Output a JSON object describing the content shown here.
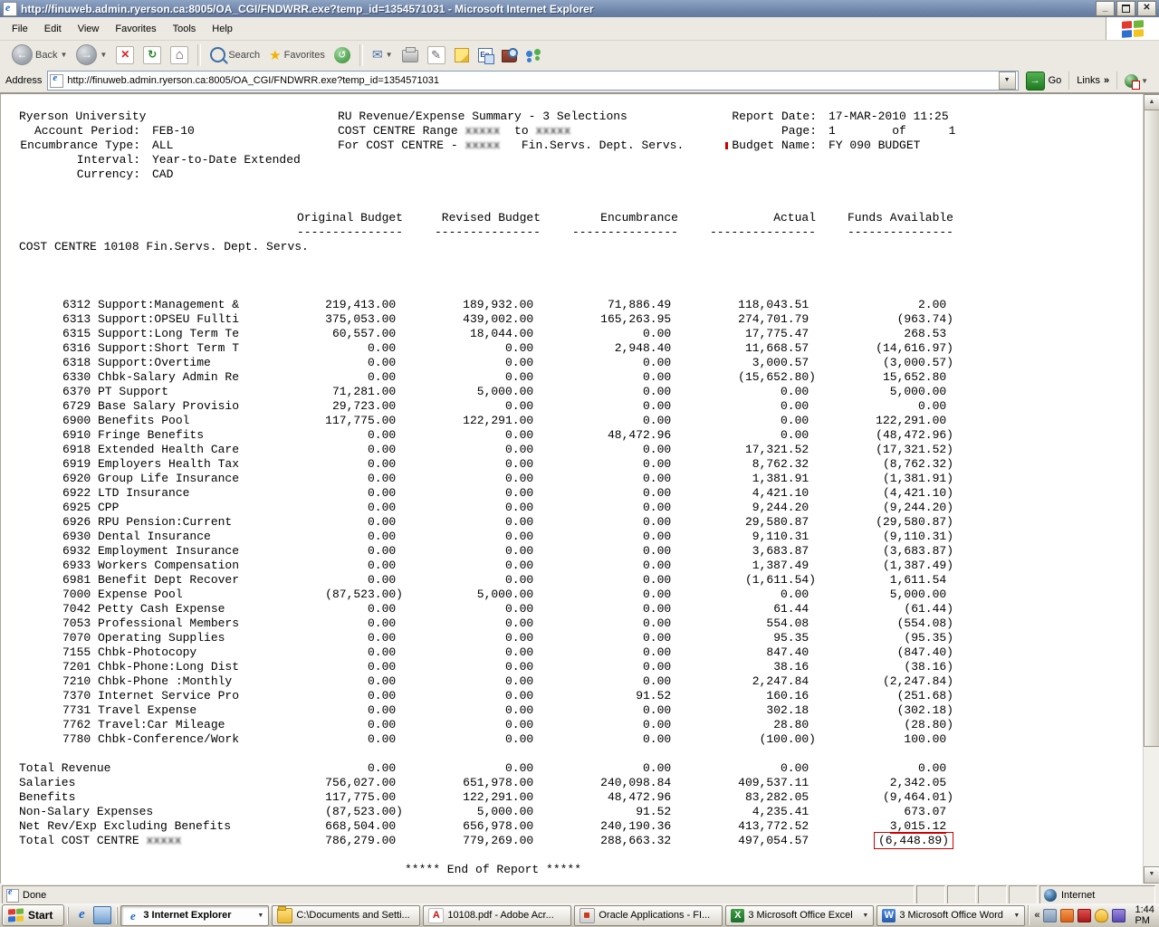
{
  "window": {
    "title": "http://finuweb.admin.ryerson.ca:8005/OA_CGI/FNDWRR.exe?temp_id=1354571031 - Microsoft Internet Explorer"
  },
  "menu": {
    "items": [
      "File",
      "Edit",
      "View",
      "Favorites",
      "Tools",
      "Help"
    ]
  },
  "toolbar": {
    "back_label": "Back",
    "search_label": "Search",
    "favorites_label": "Favorites"
  },
  "icons": {
    "ie": "e",
    "back_arrow": "←",
    "forward_arrow": "→",
    "stop": "✕",
    "refresh": "↻",
    "home": "⌂",
    "favorites_star": "★",
    "history": "↺",
    "mail": "✉",
    "edit": "✎",
    "translate_text": "En",
    "dropdown": "▼",
    "go_arrow": "→",
    "minimize": "_",
    "close": "✕",
    "up_arrow": "▲",
    "down_arrow": "▼",
    "excel": "X",
    "word": "W",
    "acrobat": "A"
  },
  "address": {
    "label": "Address",
    "url": "http://finuweb.admin.ryerson.ca:8005/OA_CGI/FNDWRR.exe?temp_id=1354571031",
    "go_label": "Go",
    "links_label": "Links",
    "chevron": "»"
  },
  "report": {
    "org": "Ryerson University",
    "left_fields": [
      {
        "label": "Account Period:",
        "value": "FEB-10"
      },
      {
        "label": "Encumbrance Type:",
        "value": "ALL"
      },
      {
        "label": "Interval:",
        "value": "Year-to-Date Extended"
      },
      {
        "label": "Currency:",
        "value": "CAD"
      }
    ],
    "title": "RU Revenue/Expense Summary - 3 Selections",
    "range_line_prefix": "COST CENTRE Range ",
    "range_redacted_1": "xxxxx",
    "range_to": "  to ",
    "range_redacted_2": "xxxxx",
    "for_line_prefix": "For COST CENTRE - ",
    "for_redacted": "xxxxx",
    "for_line_suffix": "   Fin.Servs. Dept. Servs.",
    "right_fields": [
      {
        "label": "Report Date:",
        "value": "17-MAR-2010 11:25",
        "mark": false
      },
      {
        "label": "Page:",
        "value": "1        of      1",
        "mark": false
      },
      {
        "label": "Budget Name:",
        "value": "FY 090 BUDGET",
        "mark": true
      }
    ],
    "columns": [
      "Original Budget",
      "Revised Budget",
      "Encumbrance",
      "Actual",
      "Funds Available"
    ],
    "column_underline": "---------------",
    "section_title": "COST CENTRE 10108 Fin.Servs. Dept. Servs.",
    "rows": [
      {
        "code": "6312",
        "name": "Support:Management &",
        "values": [
          "219,413.00",
          "189,932.00",
          "71,886.49",
          "118,043.51",
          "2.00"
        ]
      },
      {
        "code": "6313",
        "name": "Support:OPSEU Fullti",
        "values": [
          "375,053.00",
          "439,002.00",
          "165,263.95",
          "274,701.79",
          "(963.74)"
        ]
      },
      {
        "code": "6315",
        "name": "Support:Long Term Te",
        "values": [
          "60,557.00",
          "18,044.00",
          "0.00",
          "17,775.47",
          "268.53"
        ]
      },
      {
        "code": "6316",
        "name": "Support:Short Term T",
        "values": [
          "0.00",
          "0.00",
          "2,948.40",
          "11,668.57",
          "(14,616.97)"
        ]
      },
      {
        "code": "6318",
        "name": "Support:Overtime",
        "values": [
          "0.00",
          "0.00",
          "0.00",
          "3,000.57",
          "(3,000.57)"
        ]
      },
      {
        "code": "6330",
        "name": "Chbk-Salary Admin Re",
        "values": [
          "0.00",
          "0.00",
          "0.00",
          "(15,652.80)",
          "15,652.80"
        ]
      },
      {
        "code": "6370",
        "name": "PT Support",
        "values": [
          "71,281.00",
          "5,000.00",
          "0.00",
          "0.00",
          "5,000.00"
        ]
      },
      {
        "code": "6729",
        "name": "Base Salary Provisio",
        "values": [
          "29,723.00",
          "0.00",
          "0.00",
          "0.00",
          "0.00"
        ]
      },
      {
        "code": "6900",
        "name": "Benefits Pool",
        "values": [
          "117,775.00",
          "122,291.00",
          "0.00",
          "0.00",
          "122,291.00"
        ]
      },
      {
        "code": "6910",
        "name": "Fringe Benefits",
        "values": [
          "0.00",
          "0.00",
          "48,472.96",
          "0.00",
          "(48,472.96)"
        ]
      },
      {
        "code": "6918",
        "name": "Extended Health Care",
        "values": [
          "0.00",
          "0.00",
          "0.00",
          "17,321.52",
          "(17,321.52)"
        ]
      },
      {
        "code": "6919",
        "name": "Employers Health Tax",
        "values": [
          "0.00",
          "0.00",
          "0.00",
          "8,762.32",
          "(8,762.32)"
        ]
      },
      {
        "code": "6920",
        "name": "Group Life Insurance",
        "values": [
          "0.00",
          "0.00",
          "0.00",
          "1,381.91",
          "(1,381.91)"
        ]
      },
      {
        "code": "6922",
        "name": "LTD Insurance",
        "values": [
          "0.00",
          "0.00",
          "0.00",
          "4,421.10",
          "(4,421.10)"
        ]
      },
      {
        "code": "6925",
        "name": "CPP",
        "values": [
          "0.00",
          "0.00",
          "0.00",
          "9,244.20",
          "(9,244.20)"
        ]
      },
      {
        "code": "6926",
        "name": "RPU Pension:Current",
        "values": [
          "0.00",
          "0.00",
          "0.00",
          "29,580.87",
          "(29,580.87)"
        ]
      },
      {
        "code": "6930",
        "name": "Dental Insurance",
        "values": [
          "0.00",
          "0.00",
          "0.00",
          "9,110.31",
          "(9,110.31)"
        ]
      },
      {
        "code": "6932",
        "name": "Employment Insurance",
        "values": [
          "0.00",
          "0.00",
          "0.00",
          "3,683.87",
          "(3,683.87)"
        ]
      },
      {
        "code": "6933",
        "name": "Workers Compensation",
        "values": [
          "0.00",
          "0.00",
          "0.00",
          "1,387.49",
          "(1,387.49)"
        ]
      },
      {
        "code": "6981",
        "name": "Benefit Dept Recover",
        "values": [
          "0.00",
          "0.00",
          "0.00",
          "(1,611.54)",
          "1,611.54"
        ]
      },
      {
        "code": "7000",
        "name": "Expense Pool",
        "values": [
          "(87,523.00)",
          "5,000.00",
          "0.00",
          "0.00",
          "5,000.00"
        ]
      },
      {
        "code": "7042",
        "name": "Petty Cash Expense",
        "values": [
          "0.00",
          "0.00",
          "0.00",
          "61.44",
          "(61.44)"
        ]
      },
      {
        "code": "7053",
        "name": "Professional Members",
        "values": [
          "0.00",
          "0.00",
          "0.00",
          "554.08",
          "(554.08)"
        ]
      },
      {
        "code": "7070",
        "name": "Operating Supplies",
        "values": [
          "0.00",
          "0.00",
          "0.00",
          "95.35",
          "(95.35)"
        ]
      },
      {
        "code": "7155",
        "name": "Chbk-Photocopy",
        "values": [
          "0.00",
          "0.00",
          "0.00",
          "847.40",
          "(847.40)"
        ]
      },
      {
        "code": "7201",
        "name": "Chbk-Phone:Long Dist",
        "values": [
          "0.00",
          "0.00",
          "0.00",
          "38.16",
          "(38.16)"
        ]
      },
      {
        "code": "7210",
        "name": "Chbk-Phone :Monthly",
        "values": [
          "0.00",
          "0.00",
          "0.00",
          "2,247.84",
          "(2,247.84)"
        ]
      },
      {
        "code": "7370",
        "name": "Internet Service Pro",
        "values": [
          "0.00",
          "0.00",
          "91.52",
          "160.16",
          "(251.68)"
        ]
      },
      {
        "code": "7731",
        "name": "Travel Expense",
        "values": [
          "0.00",
          "0.00",
          "0.00",
          "302.18",
          "(302.18)"
        ]
      },
      {
        "code": "7762",
        "name": "Travel:Car Mileage",
        "values": [
          "0.00",
          "0.00",
          "0.00",
          "28.80",
          "(28.80)"
        ]
      },
      {
        "code": "7780",
        "name": "Chbk-Conference/Work",
        "values": [
          "0.00",
          "0.00",
          "0.00",
          "(100.00)",
          "100.00"
        ]
      }
    ],
    "totals": [
      {
        "name": "Total Revenue",
        "values": [
          "0.00",
          "0.00",
          "0.00",
          "0.00",
          "0.00"
        ]
      },
      {
        "name": "Salaries",
        "values": [
          "756,027.00",
          "651,978.00",
          "240,098.84",
          "409,537.11",
          "2,342.05"
        ]
      },
      {
        "name": "Benefits",
        "values": [
          "117,775.00",
          "122,291.00",
          "48,472.96",
          "83,282.05",
          "(9,464.01)"
        ]
      },
      {
        "name": "Non-Salary Expenses",
        "values": [
          "(87,523.00)",
          "5,000.00",
          "91.52",
          "4,235.41",
          "673.07"
        ]
      },
      {
        "name": "Net Rev/Exp Excluding Benefits",
        "values": [
          "668,504.00",
          "656,978.00",
          "240,190.36",
          "413,772.52",
          "3,015.12"
        ],
        "highlight": "underline"
      },
      {
        "name": "Total COST CENTRE ",
        "redacted": "xxxxx",
        "values": [
          "786,279.00",
          "779,269.00",
          "288,663.32",
          "497,054.57",
          "(6,448.89)"
        ],
        "highlight": "box"
      }
    ],
    "end_text": "***** End of Report *****",
    "highlight_color": "#cc0000"
  },
  "status": {
    "left": "Done",
    "right": "Internet"
  },
  "taskbar": {
    "start_label": "Start",
    "quick_launch": [
      {
        "name": "internet-explorer-icon"
      },
      {
        "name": "show-desktop-icon"
      }
    ],
    "buttons": [
      {
        "label": "3 Internet Explorer",
        "icon": "ie",
        "active": true,
        "dropdown": true
      },
      {
        "label": "C:\\Documents and Setti...",
        "icon": "folder",
        "active": false,
        "dropdown": false
      },
      {
        "label": "10108.pdf - Adobe Acr...",
        "icon": "acrobat",
        "active": false,
        "dropdown": false
      },
      {
        "label": "Oracle Applications - FI...",
        "icon": "oracle",
        "active": false,
        "dropdown": false
      },
      {
        "label": "3 Microsoft Office Excel",
        "icon": "excel",
        "active": false,
        "dropdown": true
      },
      {
        "label": "3 Microsoft Office Word",
        "icon": "word",
        "active": false,
        "dropdown": true
      }
    ],
    "tray_chevron": "«",
    "tray_icons": [
      {
        "name": "java-icon"
      },
      {
        "name": "java-update-icon"
      },
      {
        "name": "antivirus-icon"
      },
      {
        "name": "security-alert-icon"
      },
      {
        "name": "messenger-tray-icon"
      }
    ],
    "clock": "1:44 PM"
  }
}
